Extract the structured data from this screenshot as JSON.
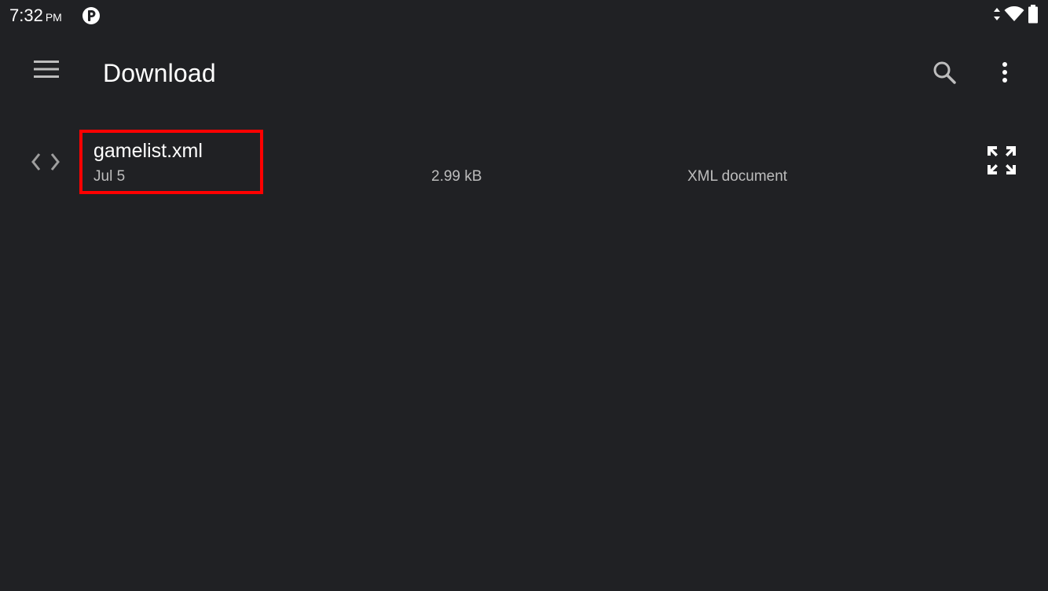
{
  "status_bar": {
    "time": "7:32",
    "ampm": "PM",
    "icons": [
      "notification-app-icon",
      "data-arrows-icon",
      "wifi-icon",
      "battery-icon"
    ]
  },
  "app_bar": {
    "title": "Download",
    "icons": [
      "menu-icon",
      "search-icon",
      "more-vert-icon"
    ]
  },
  "files": [
    {
      "name": "gamelist.xml",
      "date": "Jul 5",
      "size": "2.99 kB",
      "type": "XML document",
      "icon": "code-file-icon",
      "action_icon": "expand-preview-icon"
    }
  ],
  "colors": {
    "background": "#202124",
    "text_primary": "#ffffff",
    "text_secondary": "#bdbdbd",
    "highlight": "#ff0000"
  }
}
